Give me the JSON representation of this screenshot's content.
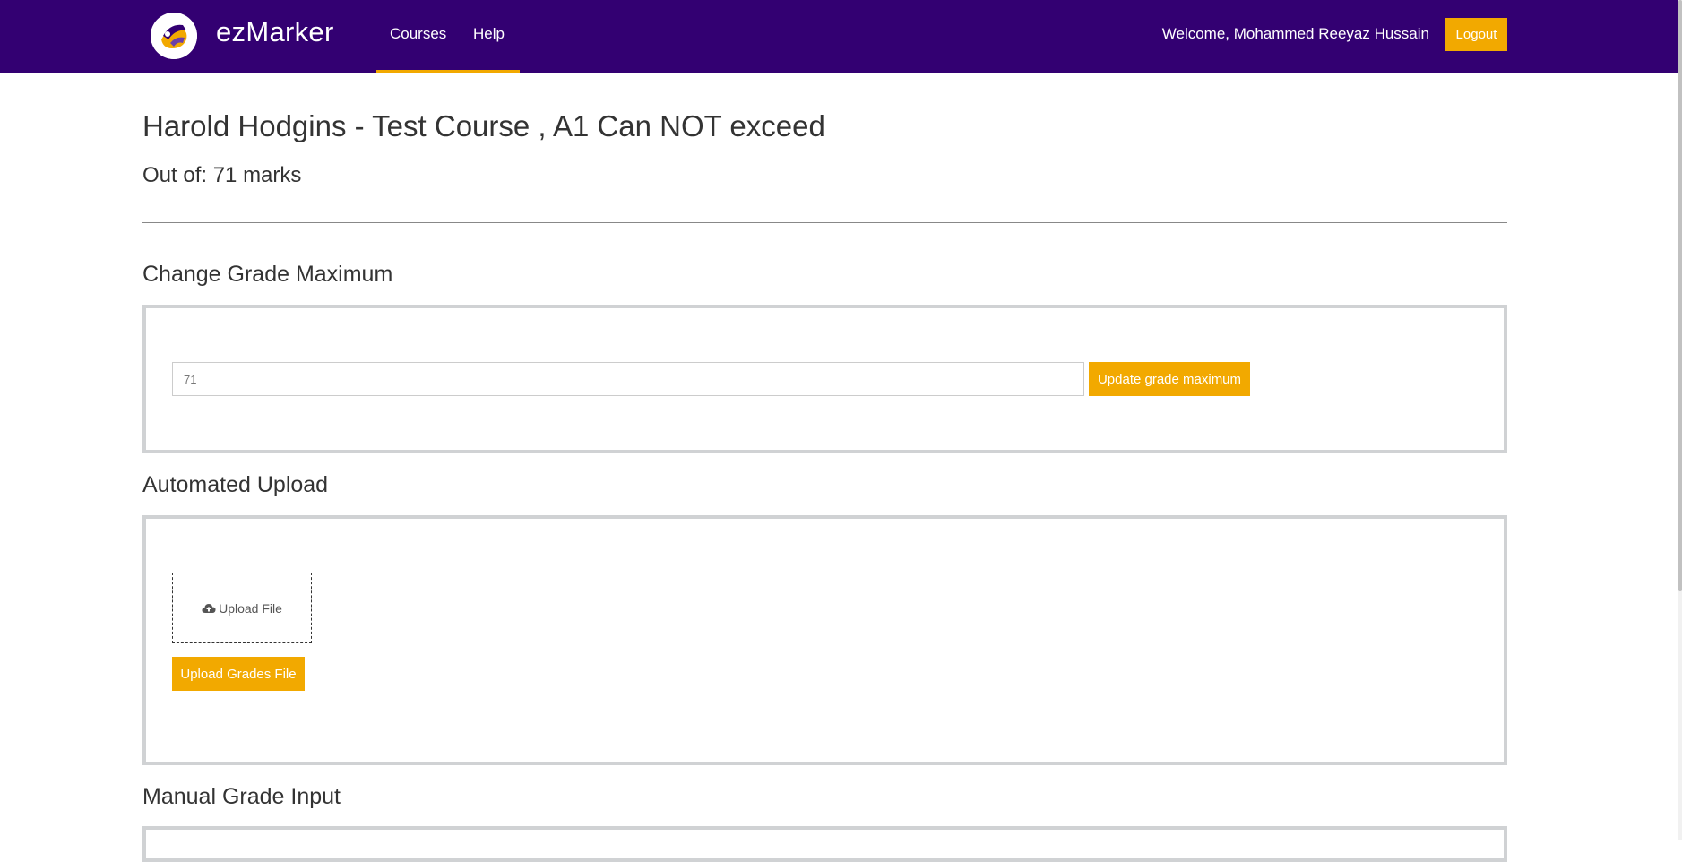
{
  "header": {
    "brand": "ezMarker",
    "nav": {
      "courses": "Courses",
      "help": "Help"
    },
    "welcome": "Welcome, Mohammed Reeyaz Hussain",
    "logout_label": "Logout"
  },
  "page": {
    "title": "Harold Hodgins - Test Course , A1 Can NOT exceed",
    "subtitle": "Out of: 71 marks"
  },
  "grade_max": {
    "heading": "Change Grade Maximum",
    "value": "71",
    "button_label": "Update grade maximum"
  },
  "automated_upload": {
    "heading": "Automated Upload",
    "dropzone_label": "Upload File",
    "dropzone_icon": "cloud-upload-icon",
    "button_label": "Upload Grades File"
  },
  "manual_input": {
    "heading": "Manual Grade Input"
  },
  "colors": {
    "navbar": "#330072",
    "accent": "#f2a900",
    "panel_border": "#d0d2d4"
  }
}
